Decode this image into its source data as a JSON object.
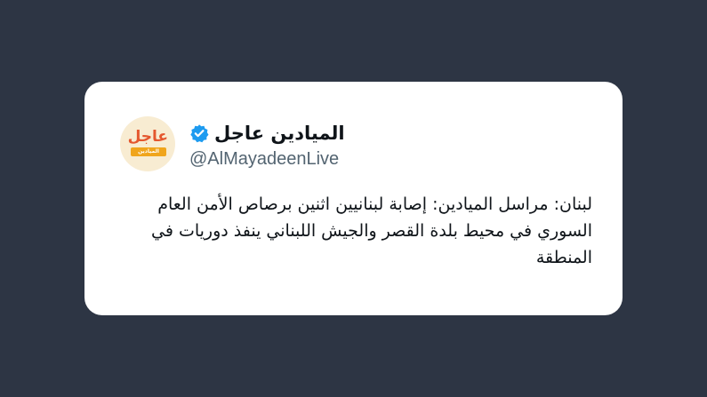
{
  "post": {
    "avatar": {
      "icon": "almayadeen-breaking-logo",
      "logo_word": "عاجل",
      "logo_sub": "الميادين",
      "bg_color": "#f8ecd2",
      "accent_color": "#e4572e"
    },
    "author": {
      "display_name": "الميادين عاجل",
      "handle": "@AlMayadeenLive",
      "verified": true,
      "verified_icon": "verified-badge-icon",
      "verified_color": "#1d9bf0"
    },
    "text": "لبنان: مراسل الميادين: إصابة لبنانيين اثنين برصاص الأمن العام السوري في محيط بلدة القصر والجيش اللبناني ينفذ دوريات في المنطقة"
  },
  "colors": {
    "page_background": "#2d3544",
    "card_background": "#ffffff",
    "text_primary": "#0f1419",
    "text_secondary": "#536471"
  }
}
